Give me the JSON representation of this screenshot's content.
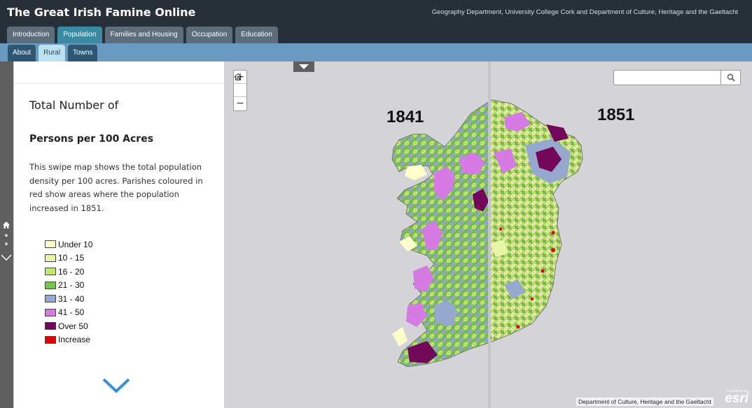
{
  "header": {
    "title": "The Great Irish Famine Online",
    "subtitle": "Geography Department, University College Cork and Department of Culture, Heritage and the Gaeltacht"
  },
  "tabs": [
    {
      "label": "Introduction",
      "active": false
    },
    {
      "label": "Population",
      "active": true
    },
    {
      "label": "Families and Housing",
      "active": false
    },
    {
      "label": "Occupation",
      "active": false
    },
    {
      "label": "Education",
      "active": false
    }
  ],
  "subtabs": [
    {
      "label": "About",
      "active": false
    },
    {
      "label": "Rural",
      "active": true
    },
    {
      "label": "Towns",
      "active": false
    }
  ],
  "panel": {
    "heading1": "Total Number of",
    "heading2": "Persons per 100 Acres",
    "description": "This swipe map shows the total population density per 100 acres. Parishes coloured in red show areas where the population increased in 1851."
  },
  "legend": [
    {
      "label": "Under 10",
      "color": "#ffffcc"
    },
    {
      "label": "10 - 15",
      "color": "#e6f5a8"
    },
    {
      "label": "16 - 20",
      "color": "#c2e872"
    },
    {
      "label": "21 - 30",
      "color": "#7bc255"
    },
    {
      "label": "31 - 40",
      "color": "#97a8cf"
    },
    {
      "label": "41 - 50",
      "color": "#d67be3"
    },
    {
      "label": "Over 50",
      "color": "#73075a"
    },
    {
      "label": "Increase",
      "color": "#e00000"
    }
  ],
  "map": {
    "left_year": "1841",
    "right_year": "1851",
    "search_placeholder": "",
    "zoom_in": "+",
    "zoom_out": "−",
    "attribution": "Department of Culture, Heritage and the Gaeltacht",
    "esri_powered": "POWERED BY",
    "esri_word": "esri",
    "background_color": "#d4d3d8",
    "border_color": "#666666"
  },
  "icons": {
    "home": "home-icon",
    "search": "search-icon",
    "chevron_down": "chevron-down-icon",
    "swipe": "triangle-down-icon"
  }
}
